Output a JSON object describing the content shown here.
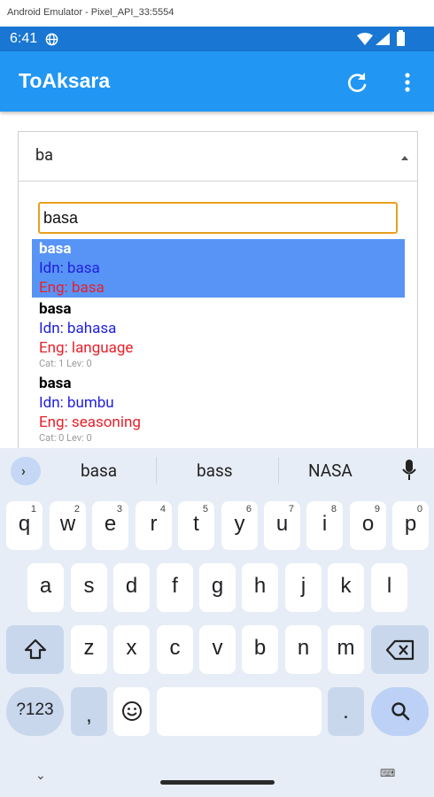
{
  "window": {
    "title": "Android Emulator - Pixel_API_33:5554"
  },
  "status_bar": {
    "time": "6:41"
  },
  "app_bar": {
    "title": "ToAksara"
  },
  "spinner": {
    "selected_value": "ba"
  },
  "search": {
    "value": "basa"
  },
  "results": [
    {
      "word": "basa",
      "idn": "Idn: basa",
      "eng": "Eng: basa",
      "meta": "",
      "selected": true
    },
    {
      "word": "basa",
      "idn": "Idn: bahasa",
      "eng": "Eng: language",
      "meta": "Cat: 1 Lev: 0",
      "selected": false
    },
    {
      "word": "basa",
      "idn": "Idn: bumbu",
      "eng": "Eng: seasoning",
      "meta": "Cat: 0 Lev: 0",
      "selected": false
    }
  ],
  "keyboard": {
    "suggestions": [
      "basa",
      "bass",
      "NASA"
    ],
    "row1": [
      [
        "q",
        "1"
      ],
      [
        "w",
        "2"
      ],
      [
        "e",
        "3"
      ],
      [
        "r",
        "4"
      ],
      [
        "t",
        "5"
      ],
      [
        "y",
        "6"
      ],
      [
        "u",
        "7"
      ],
      [
        "i",
        "8"
      ],
      [
        "o",
        "9"
      ],
      [
        "p",
        "0"
      ]
    ],
    "row2": [
      "a",
      "s",
      "d",
      "f",
      "g",
      "h",
      "j",
      "k",
      "l"
    ],
    "row3": [
      "z",
      "x",
      "c",
      "v",
      "b",
      "n",
      "m"
    ],
    "symbols_label": "?123",
    "comma": ",",
    "period": "."
  }
}
